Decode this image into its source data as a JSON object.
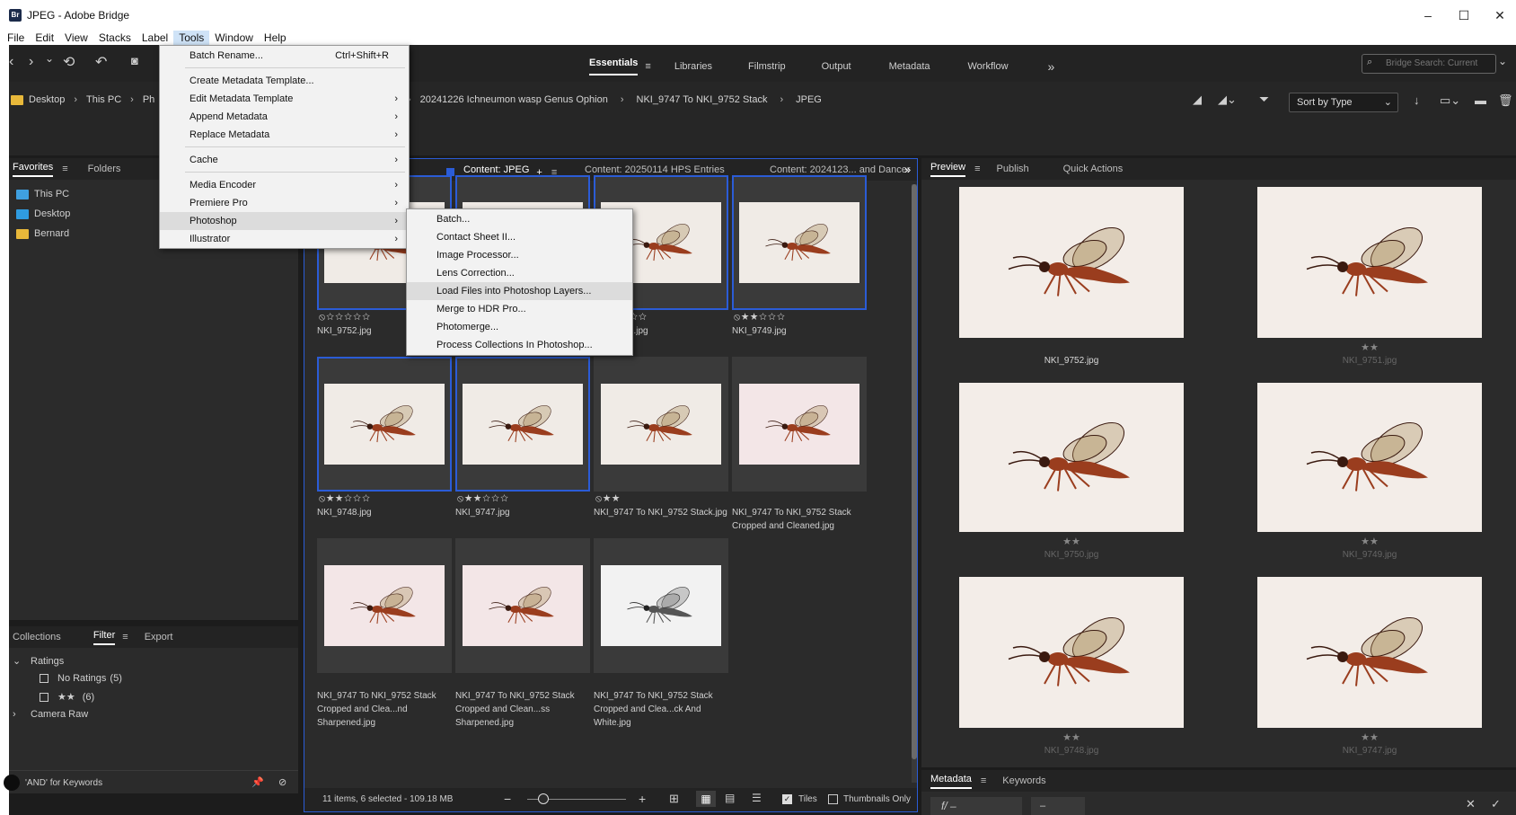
{
  "window": {
    "title": "JPEG - Adobe Bridge",
    "app_badge": "Br",
    "minimize": "–",
    "maximize": "☐",
    "close": "✕"
  },
  "menubar": [
    "File",
    "Edit",
    "View",
    "Stacks",
    "Label",
    "Tools",
    "Window",
    "Help"
  ],
  "workspaces": {
    "items": [
      "Essentials",
      "Libraries",
      "Filmstrip",
      "Output",
      "Metadata",
      "Workflow"
    ],
    "active": "Essentials",
    "more": "»"
  },
  "search": {
    "placeholder": "Bridge Search: Current"
  },
  "breadcrumb": {
    "items": [
      "Desktop",
      "This PC",
      "Ph",
      "20241226 Ichneumon wasp Genus Ophion",
      "NKI_9747 To NKI_9752 Stack",
      "JPEG"
    ],
    "separator": "›"
  },
  "sort": {
    "label": "Sort by Type"
  },
  "left_panel": {
    "tabs": [
      "Favorites",
      "Folders"
    ],
    "favorites": [
      {
        "label": "This PC",
        "color": "#3fa0e0"
      },
      {
        "label": "Desktop",
        "color": "#2f9be0"
      },
      {
        "label": "Bernard",
        "color": "#e8b83a"
      }
    ]
  },
  "filter_panel": {
    "tabs": [
      "Collections",
      "Filter",
      "Export"
    ],
    "ratings_header": "Ratings",
    "ratings": [
      {
        "label": "No Ratings",
        "count": "(5)"
      },
      {
        "label": "★★",
        "count": "(6)"
      }
    ],
    "camera_raw": "Camera Raw",
    "footer_text": "'AND' for Keywords"
  },
  "content": {
    "tabs": [
      "Content: JPEG",
      "Content: 20250114 HPS Entries",
      "Content: 2024123... and Dancer"
    ],
    "add": "+",
    "status": "11 items, 6 selected - 109.18 MB",
    "zoom_minus": "−",
    "zoom_plus": "+",
    "tiles_label": "Tiles",
    "thumbs_only_label": "Thumbnails Only",
    "items": [
      {
        "name": "NKI_9752.jpg",
        "stars": 0,
        "reject": true,
        "selected": true,
        "tone": "cream"
      },
      {
        "name": "NKI_9751.jpg",
        "stars": 2,
        "reject": false,
        "selected": true,
        "tone": "cream"
      },
      {
        "name": "NKI_9750.jpg",
        "stars": 2,
        "reject": true,
        "selected": true,
        "tone": "cream"
      },
      {
        "name": "NKI_9749.jpg",
        "stars": 2,
        "reject": true,
        "selected": true,
        "tone": "cream"
      },
      {
        "name": "NKI_9748.jpg",
        "stars": 2,
        "reject": true,
        "selected": true,
        "tone": "cream"
      },
      {
        "name": "NKI_9747.jpg",
        "stars": 2,
        "reject": true,
        "selected": true,
        "tone": "cream"
      },
      {
        "name": "NKI_9747 To NKI_9752 Stack.jpg",
        "stars": 2,
        "reject": true,
        "selected": false,
        "tone": "cream"
      },
      {
        "name": "NKI_9747 To NKI_9752 Stack Cropped and Cleaned.jpg",
        "stars": 0,
        "reject": false,
        "selected": false,
        "tone": "pink"
      },
      {
        "name": "NKI_9747 To NKI_9752 Stack Cropped and Clea...nd Sharpened.jpg",
        "stars": 0,
        "reject": false,
        "selected": false,
        "tone": "pink"
      },
      {
        "name": "NKI_9747 To NKI_9752 Stack Cropped and Clean...ss Sharpened.jpg",
        "stars": 0,
        "reject": false,
        "selected": false,
        "tone": "pink"
      },
      {
        "name": "NKI_9747 To NKI_9752 Stack Cropped and Clea...ck And White.jpg",
        "stars": 0,
        "reject": false,
        "selected": false,
        "tone": "gray"
      }
    ]
  },
  "preview_panel": {
    "tabs": [
      "Preview",
      "Publish",
      "Quick Actions"
    ],
    "items": [
      {
        "name": "NKI_9752.jpg",
        "stars": ""
      },
      {
        "name": "NKI_9751.jpg",
        "stars": "★★"
      },
      {
        "name": "NKI_9750.jpg",
        "stars": "★★"
      },
      {
        "name": "NKI_9749.jpg",
        "stars": "★★"
      },
      {
        "name": "NKI_9748.jpg",
        "stars": "★★"
      },
      {
        "name": "NKI_9747.jpg",
        "stars": "★★"
      }
    ]
  },
  "metadata_panel": {
    "tabs": [
      "Metadata",
      "Keywords"
    ],
    "fstop": "f/ –",
    "dash": "–",
    "close": "✕",
    "apply": "✓"
  },
  "tools_menu": {
    "items": [
      {
        "label": "Batch Rename...",
        "shortcut": "Ctrl+Shift+R",
        "submenu": false
      },
      {
        "label": "Create Metadata Template...",
        "shortcut": "",
        "submenu": false
      },
      {
        "label": "Edit Metadata Template",
        "shortcut": "",
        "submenu": true
      },
      {
        "label": "Append Metadata",
        "shortcut": "",
        "submenu": true
      },
      {
        "label": "Replace Metadata",
        "shortcut": "",
        "submenu": true
      },
      {
        "label": "Cache",
        "shortcut": "",
        "submenu": true
      },
      {
        "label": "Media Encoder",
        "shortcut": "",
        "submenu": true
      },
      {
        "label": "Premiere Pro",
        "shortcut": "",
        "submenu": true
      },
      {
        "label": "Photoshop",
        "shortcut": "",
        "submenu": true,
        "highlighted": true
      },
      {
        "label": "Illustrator",
        "shortcut": "",
        "submenu": true
      }
    ]
  },
  "photoshop_submenu": {
    "items": [
      "Batch...",
      "Contact Sheet II...",
      "Image Processor...",
      "Lens Correction...",
      "Load Files into Photoshop Layers...",
      "Merge to HDR Pro...",
      "Photomerge...",
      "Process Collections In Photoshop..."
    ],
    "highlighted_index": 4
  },
  "accent_color": "#2b5cd6"
}
